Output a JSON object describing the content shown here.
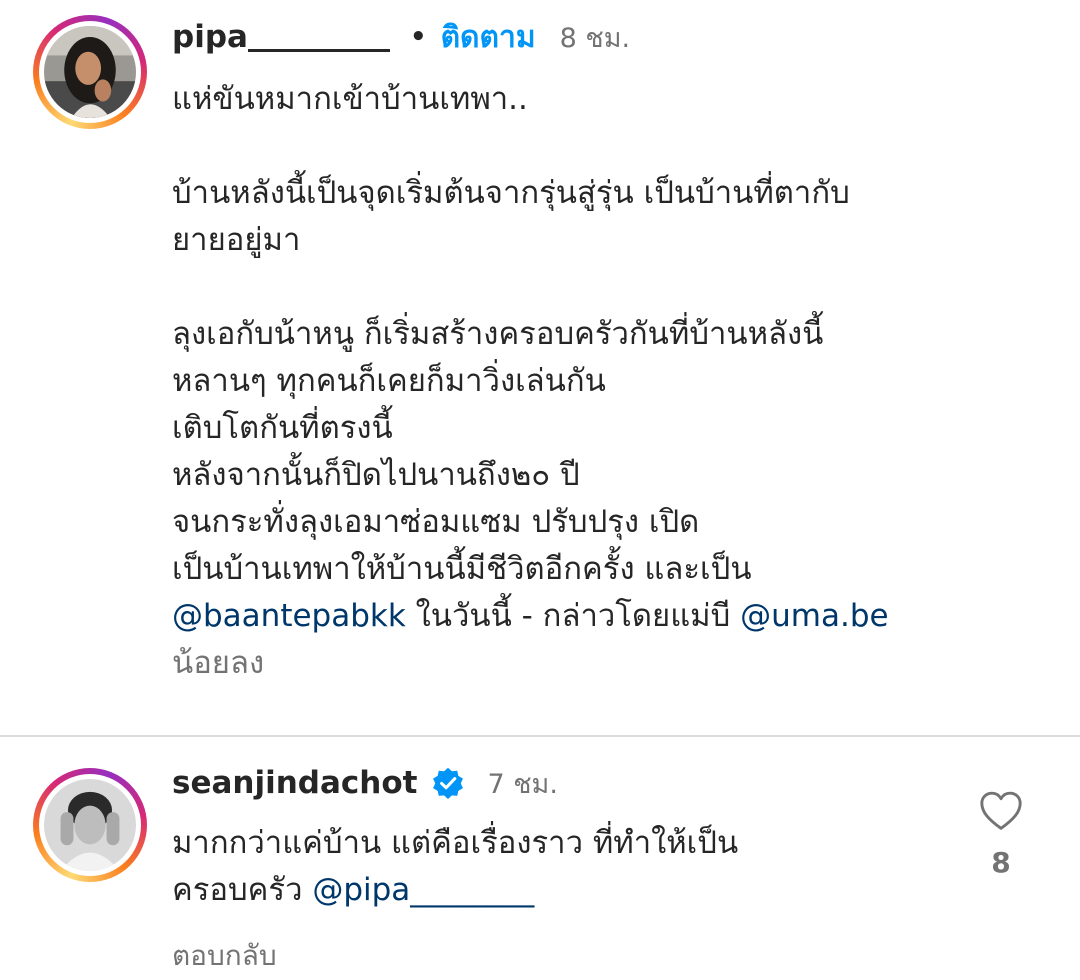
{
  "comment1": {
    "username": "pipa",
    "separator": "•",
    "follow_label": "ติดตาม",
    "time": "8 ชม.",
    "text_lines": [
      "แห่ขันหมากเข้าบ้านเทพา..",
      "",
      "บ้านหลังนี้เป็นจุดเริ่มต้นจากรุ่นสู่รุ่น เป็นบ้านที่ตากับ",
      "ยายอยู่มา",
      "",
      "ลุงเอกับน้าหนู ก็เริ่มสร้างครอบครัวกันที่บ้านหลังนี้",
      "หลานๆ ทุกคนก็เคยก็มาวิ่งเล่นกัน",
      "เติบโตกันที่ตรงนี้",
      "หลังจากนั้นก็ปิดไปนานถึง๒๐ ปี",
      "จนกระทั่งลุงเอมาซ่อมแซม ปรับปรุง เปิด",
      "เป็นบ้านเทพาให้บ้านนี้มีชีวิตอีกครั้ง และเป็น"
    ],
    "last_line": {
      "mention1": "@baantepabkk",
      "middle": " ในวันนี้ - กล่าวโดยแม่บี ",
      "mention2": "@uma.be"
    },
    "show_less": "น้อยลง"
  },
  "comment2": {
    "username": "seanjindachot",
    "verified_icon": "verified-badge-icon",
    "time": "7 ชม.",
    "line1": "มากกว่าแค่บ้าน แต่คือเรื่องราว ที่ทำให้เป็น",
    "line2_prefix": "ครอบครัว ",
    "mention": "@pipa________",
    "reply_label": "ตอบกลับ",
    "like_icon": "heart-outline-icon",
    "like_count": "8"
  },
  "colors": {
    "follow_blue": "#0095f6",
    "mention_blue": "#00376b",
    "verified_blue": "#0095f6",
    "muted_gray": "#737373"
  }
}
